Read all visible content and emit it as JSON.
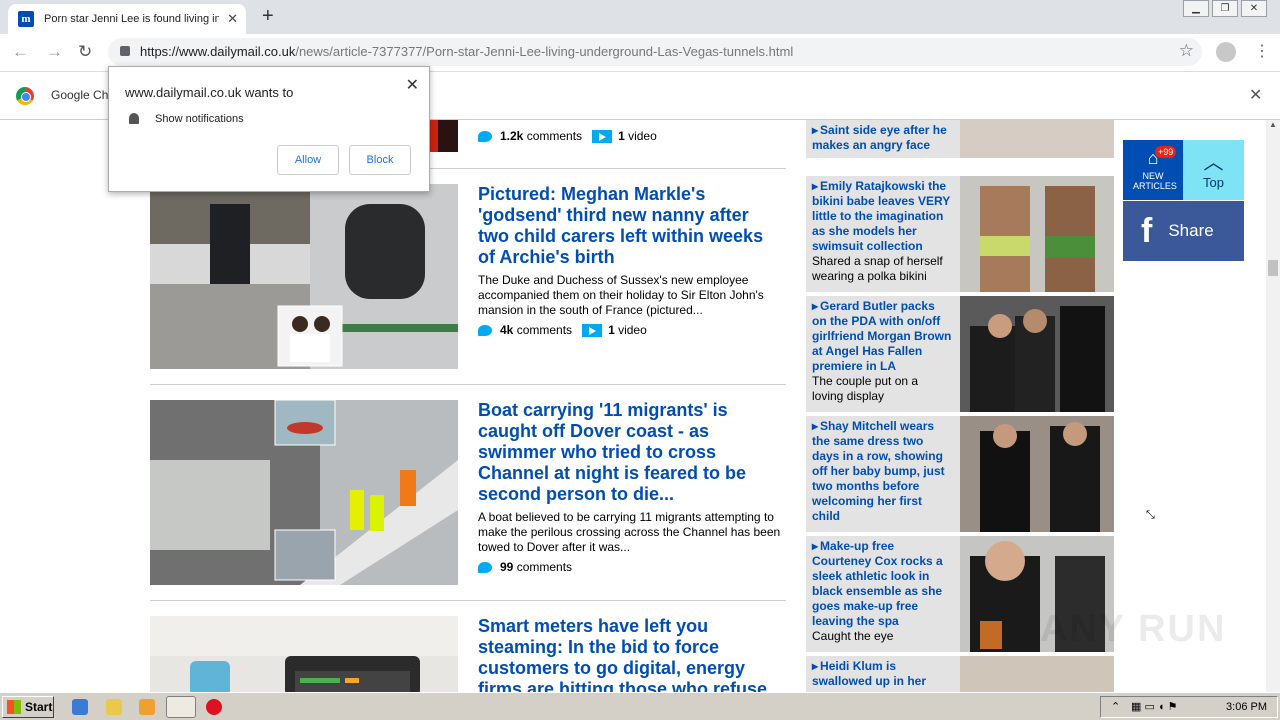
{
  "browser": {
    "tab_title": "Porn star Jenni Lee is found living in",
    "url_domain": "https://www.dailymail.co.uk",
    "url_path": "/news/article-7377377/Porn-star-Jenni-Lee-living-underground-Las-Vegas-tunnels.html",
    "infobar_text": "Google Ch"
  },
  "popup": {
    "title": "www.dailymail.co.uk wants to",
    "permission": "Show notifications",
    "allow": "Allow",
    "block": "Block"
  },
  "articles": [
    {
      "comments": "1.2k",
      "comments_label": "comments",
      "videos": "1",
      "videos_label": "video"
    },
    {
      "headline": "Pictured: Meghan Markle's 'godsend' third new nanny after two child carers left within weeks of Archie's birth",
      "excerpt": "The Duke and Duchess of Sussex's new employee accompanied them on their holiday to Sir Elton John's mansion in the south of France (pictured...",
      "comments": "4k",
      "comments_label": "comments",
      "videos": "1",
      "videos_label": "video"
    },
    {
      "headline": "Boat carrying '11 migrants' is caught off Dover coast - as swimmer who tried to cross Channel at night is feared to be second person to die...",
      "excerpt": "A boat believed to be carrying 11 migrants attempting to make the perilous crossing across the Channel has been towed to Dover after it was...",
      "comments": "99",
      "comments_label": "comments"
    },
    {
      "headline": "Smart meters have left you steaming: In the bid to force customers to go digital, energy firms are hitting those who refuse"
    }
  ],
  "sidebar": [
    {
      "title": "Saint side eye after he makes an angry face",
      "sub": ""
    },
    {
      "title": "Emily Ratajkowski the bikini babe leaves VERY little to the imagination as she models her swimsuit collection",
      "sub": "Shared a snap of herself wearing a polka bikini"
    },
    {
      "title": "Gerard Butler packs on the PDA with on/off girlfriend Morgan Brown at Angel Has Fallen premiere in LA",
      "sub": "The couple put on a loving display"
    },
    {
      "title": "Shay Mitchell wears the same dress two days in a row, showing off her baby bump, just two months before welcoming her first child",
      "sub": ""
    },
    {
      "title": "Make-up free Courteney Cox rocks a sleek athletic look in black ensemble as she goes make-up free leaving the spa",
      "sub": "Caught the eye"
    },
    {
      "title": "Heidi Klum is swallowed up in her",
      "sub": ""
    }
  ],
  "widgets": {
    "badge": "+99",
    "new_articles": "NEW ARTICLES",
    "top": "Top",
    "share": "Share"
  },
  "taskbar": {
    "start": "Start",
    "clock": "3:06 PM"
  },
  "watermark": "ANY RUN"
}
